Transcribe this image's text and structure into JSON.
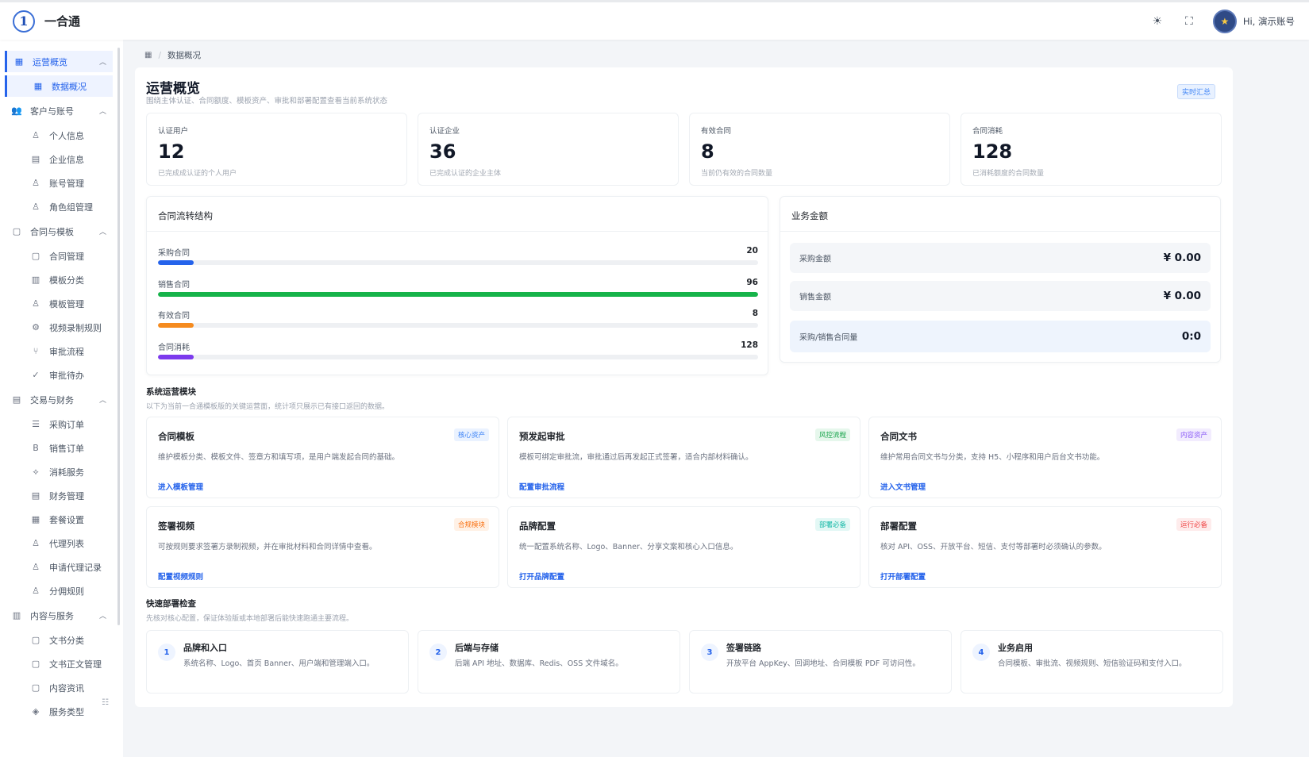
{
  "app": {
    "title": "一合通",
    "logo_glyph": "1"
  },
  "header": {
    "theme_icon": "☀",
    "fullscreen_icon": "⛶",
    "avatar_glyph": "★",
    "greeting": "Hi, 演示账号"
  },
  "sidebar": {
    "groups": [
      {
        "label": "运营概览",
        "icon": "grid-icon",
        "glyph": "▦",
        "active": true,
        "children": [
          {
            "label": "数据概况",
            "icon": "grid-icon",
            "glyph": "▦",
            "active": true
          }
        ]
      },
      {
        "label": "客户与账号",
        "icon": "users-icon",
        "glyph": "👥",
        "children": [
          {
            "label": "个人信息",
            "icon": "user-icon",
            "glyph": "♙"
          },
          {
            "label": "企业信息",
            "icon": "building-icon",
            "glyph": "▤"
          },
          {
            "label": "账号管理",
            "icon": "users-icon",
            "glyph": "♙"
          },
          {
            "label": "角色组管理",
            "icon": "users-icon",
            "glyph": "♙"
          }
        ]
      },
      {
        "label": "合同与模板",
        "icon": "document-icon",
        "glyph": "▢",
        "children": [
          {
            "label": "合同管理",
            "icon": "document-icon",
            "glyph": "▢"
          },
          {
            "label": "模板分类",
            "icon": "book-icon",
            "glyph": "▥"
          },
          {
            "label": "模板管理",
            "icon": "users-icon",
            "glyph": "♙"
          },
          {
            "label": "视频录制规则",
            "icon": "gear-icon",
            "glyph": "⚙"
          },
          {
            "label": "审批流程",
            "icon": "branch-icon",
            "glyph": "⑂"
          },
          {
            "label": "审批待办",
            "icon": "check-circle-icon",
            "glyph": "✓"
          }
        ]
      },
      {
        "label": "交易与财务",
        "icon": "table-icon",
        "glyph": "▤",
        "children": [
          {
            "label": "采购订单",
            "icon": "list-icon",
            "glyph": "☰"
          },
          {
            "label": "销售订单",
            "icon": "b-icon",
            "glyph": "B"
          },
          {
            "label": "消耗服务",
            "icon": "service-icon",
            "glyph": "⟡"
          },
          {
            "label": "财务管理",
            "icon": "table-icon",
            "glyph": "▤"
          },
          {
            "label": "套餐设置",
            "icon": "grid-icon",
            "glyph": "▦"
          },
          {
            "label": "代理列表",
            "icon": "users-icon",
            "glyph": "♙"
          },
          {
            "label": "申请代理记录",
            "icon": "users-icon",
            "glyph": "♙"
          },
          {
            "label": "分佣规则",
            "icon": "users-icon",
            "glyph": "♙"
          }
        ]
      },
      {
        "label": "内容与服务",
        "icon": "book-icon",
        "glyph": "▥",
        "children": [
          {
            "label": "文书分类",
            "icon": "document-icon",
            "glyph": "▢"
          },
          {
            "label": "文书正文管理",
            "icon": "document-icon",
            "glyph": "▢"
          },
          {
            "label": "内容资讯",
            "icon": "document-icon",
            "glyph": "▢"
          },
          {
            "label": "服务类型",
            "icon": "tag-icon",
            "glyph": "◈"
          }
        ]
      }
    ],
    "collapse_glyph": "☷"
  },
  "breadcrumb": {
    "home_glyph": "▦",
    "sep": "/",
    "current": "数据概况"
  },
  "page": {
    "title": "运营概览",
    "subtitle": "围绕主体认证、合同额度、模板资产、审批和部署配置查看当前系统状态",
    "badge": "实时汇总"
  },
  "stats": [
    {
      "label": "认证用户",
      "value": "12",
      "desc": "已完成成认证的个人用户"
    },
    {
      "label": "认证企业",
      "value": "36",
      "desc": "已完成认证的企业主体"
    },
    {
      "label": "有效合同",
      "value": "8",
      "desc": "当前仍有效的合同数量"
    },
    {
      "label": "合同消耗",
      "value": "128",
      "desc": "已消耗额度的合同数量"
    }
  ],
  "flow": {
    "title": "合同流转结构",
    "max": 128,
    "rows": [
      {
        "label": "采购合同",
        "value": 20,
        "fraction": 0.06,
        "color": "#2563eb"
      },
      {
        "label": "销售合同",
        "value": 96,
        "fraction": 1.0,
        "color": "#16b34a"
      },
      {
        "label": "有效合同",
        "value": 8,
        "fraction": 0.06,
        "color": "#f58b1f"
      },
      {
        "label": "合同消耗",
        "value": 128,
        "fraction": 0.06,
        "color": "#7c3aed"
      }
    ]
  },
  "money": {
    "title": "业务金额",
    "rows": [
      {
        "label": "采购金额",
        "value": "¥ 0.00"
      },
      {
        "label": "销售金额",
        "value": "¥ 0.00"
      },
      {
        "label": "采购/销售合同量",
        "value": "0:0"
      }
    ]
  },
  "modules": {
    "title": "系统运营模块",
    "subtitle": "以下为当前一合通模板版的关键运营面，统计项只展示已有接口返回的数据。",
    "items": [
      {
        "title": "合同模板",
        "tag": "核心资产",
        "tag_color": "#3b82f6",
        "tag_bg": "#eaf2ff",
        "desc": "维护模板分类、模板文件、签章方和填写项，是用户端发起合同的基础。",
        "link": "进入模板管理"
      },
      {
        "title": "预发起审批",
        "tag": "风控流程",
        "tag_color": "#16a34a",
        "tag_bg": "#e6f7ec",
        "desc": "模板可绑定审批流，审批通过后再发起正式签署，适合内部材料确认。",
        "link": "配置审批流程"
      },
      {
        "title": "合同文书",
        "tag": "内容资产",
        "tag_color": "#8b5cf6",
        "tag_bg": "#f2ecfe",
        "desc": "维护常用合同文书与分类，支持 H5、小程序和用户后台文书功能。",
        "link": "进入文书管理"
      },
      {
        "title": "签署视频",
        "tag": "合规模块",
        "tag_color": "#f97316",
        "tag_bg": "#fff1e6",
        "desc": "可按规则要求签署方录制视频，并在审批材料和合同详情中查看。",
        "link": "配置视频规则"
      },
      {
        "title": "品牌配置",
        "tag": "部署必备",
        "tag_color": "#14b8a6",
        "tag_bg": "#e3f8f5",
        "desc": "统一配置系统名称、Logo、Banner、分享文案和核心入口信息。",
        "link": "打开品牌配置"
      },
      {
        "title": "部署配置",
        "tag": "运行必备",
        "tag_color": "#ef4444",
        "tag_bg": "#feecec",
        "desc": "核对 API、OSS、开放平台、短信、支付等部署时必须确认的参数。",
        "link": "打开部署配置"
      }
    ]
  },
  "checks": {
    "title": "快速部署检查",
    "subtitle": "先核对核心配置，保证体验版或本地部署后能快速跑通主要流程。",
    "items": [
      {
        "num": "1",
        "title": "品牌和入口",
        "desc": "系统名称、Logo、首页 Banner、用户端和管理端入口。"
      },
      {
        "num": "2",
        "title": "后端与存储",
        "desc": "后端 API 地址、数据库、Redis、OSS 文件域名。"
      },
      {
        "num": "3",
        "title": "签署链路",
        "desc": "开放平台 AppKey、回调地址、合同模板 PDF 可访问性。"
      },
      {
        "num": "4",
        "title": "业务启用",
        "desc": "合同模板、审批流、视频规则、短信验证码和支付入口。"
      }
    ]
  }
}
